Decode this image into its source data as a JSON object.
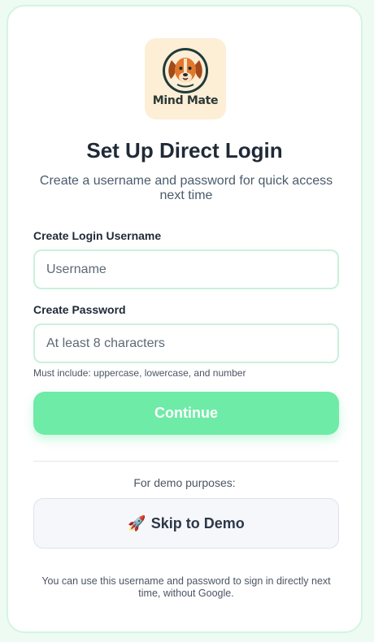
{
  "brand": {
    "name": "Mind Mate"
  },
  "header": {
    "title": "Set Up Direct Login",
    "subtitle": "Create a username and password for quick access next time"
  },
  "form": {
    "username_label": "Create Login Username",
    "username_placeholder": "Username",
    "username_value": "",
    "password_label": "Create Password",
    "password_placeholder": "At least 8 characters",
    "password_value": "",
    "password_hint": "Must include: uppercase, lowercase, and number",
    "continue_label": "Continue"
  },
  "demo": {
    "label": "For demo purposes:",
    "rocket_icon": "🚀",
    "skip_label": "Skip to Demo"
  },
  "footer": {
    "note": "You can use this username and password to sign in directly next time, without Google."
  },
  "colors": {
    "accent": "#6eeba6",
    "input_border": "#c9f1dc",
    "logo_bg": "#fdeed6",
    "page_bg": "#eefbf3"
  }
}
